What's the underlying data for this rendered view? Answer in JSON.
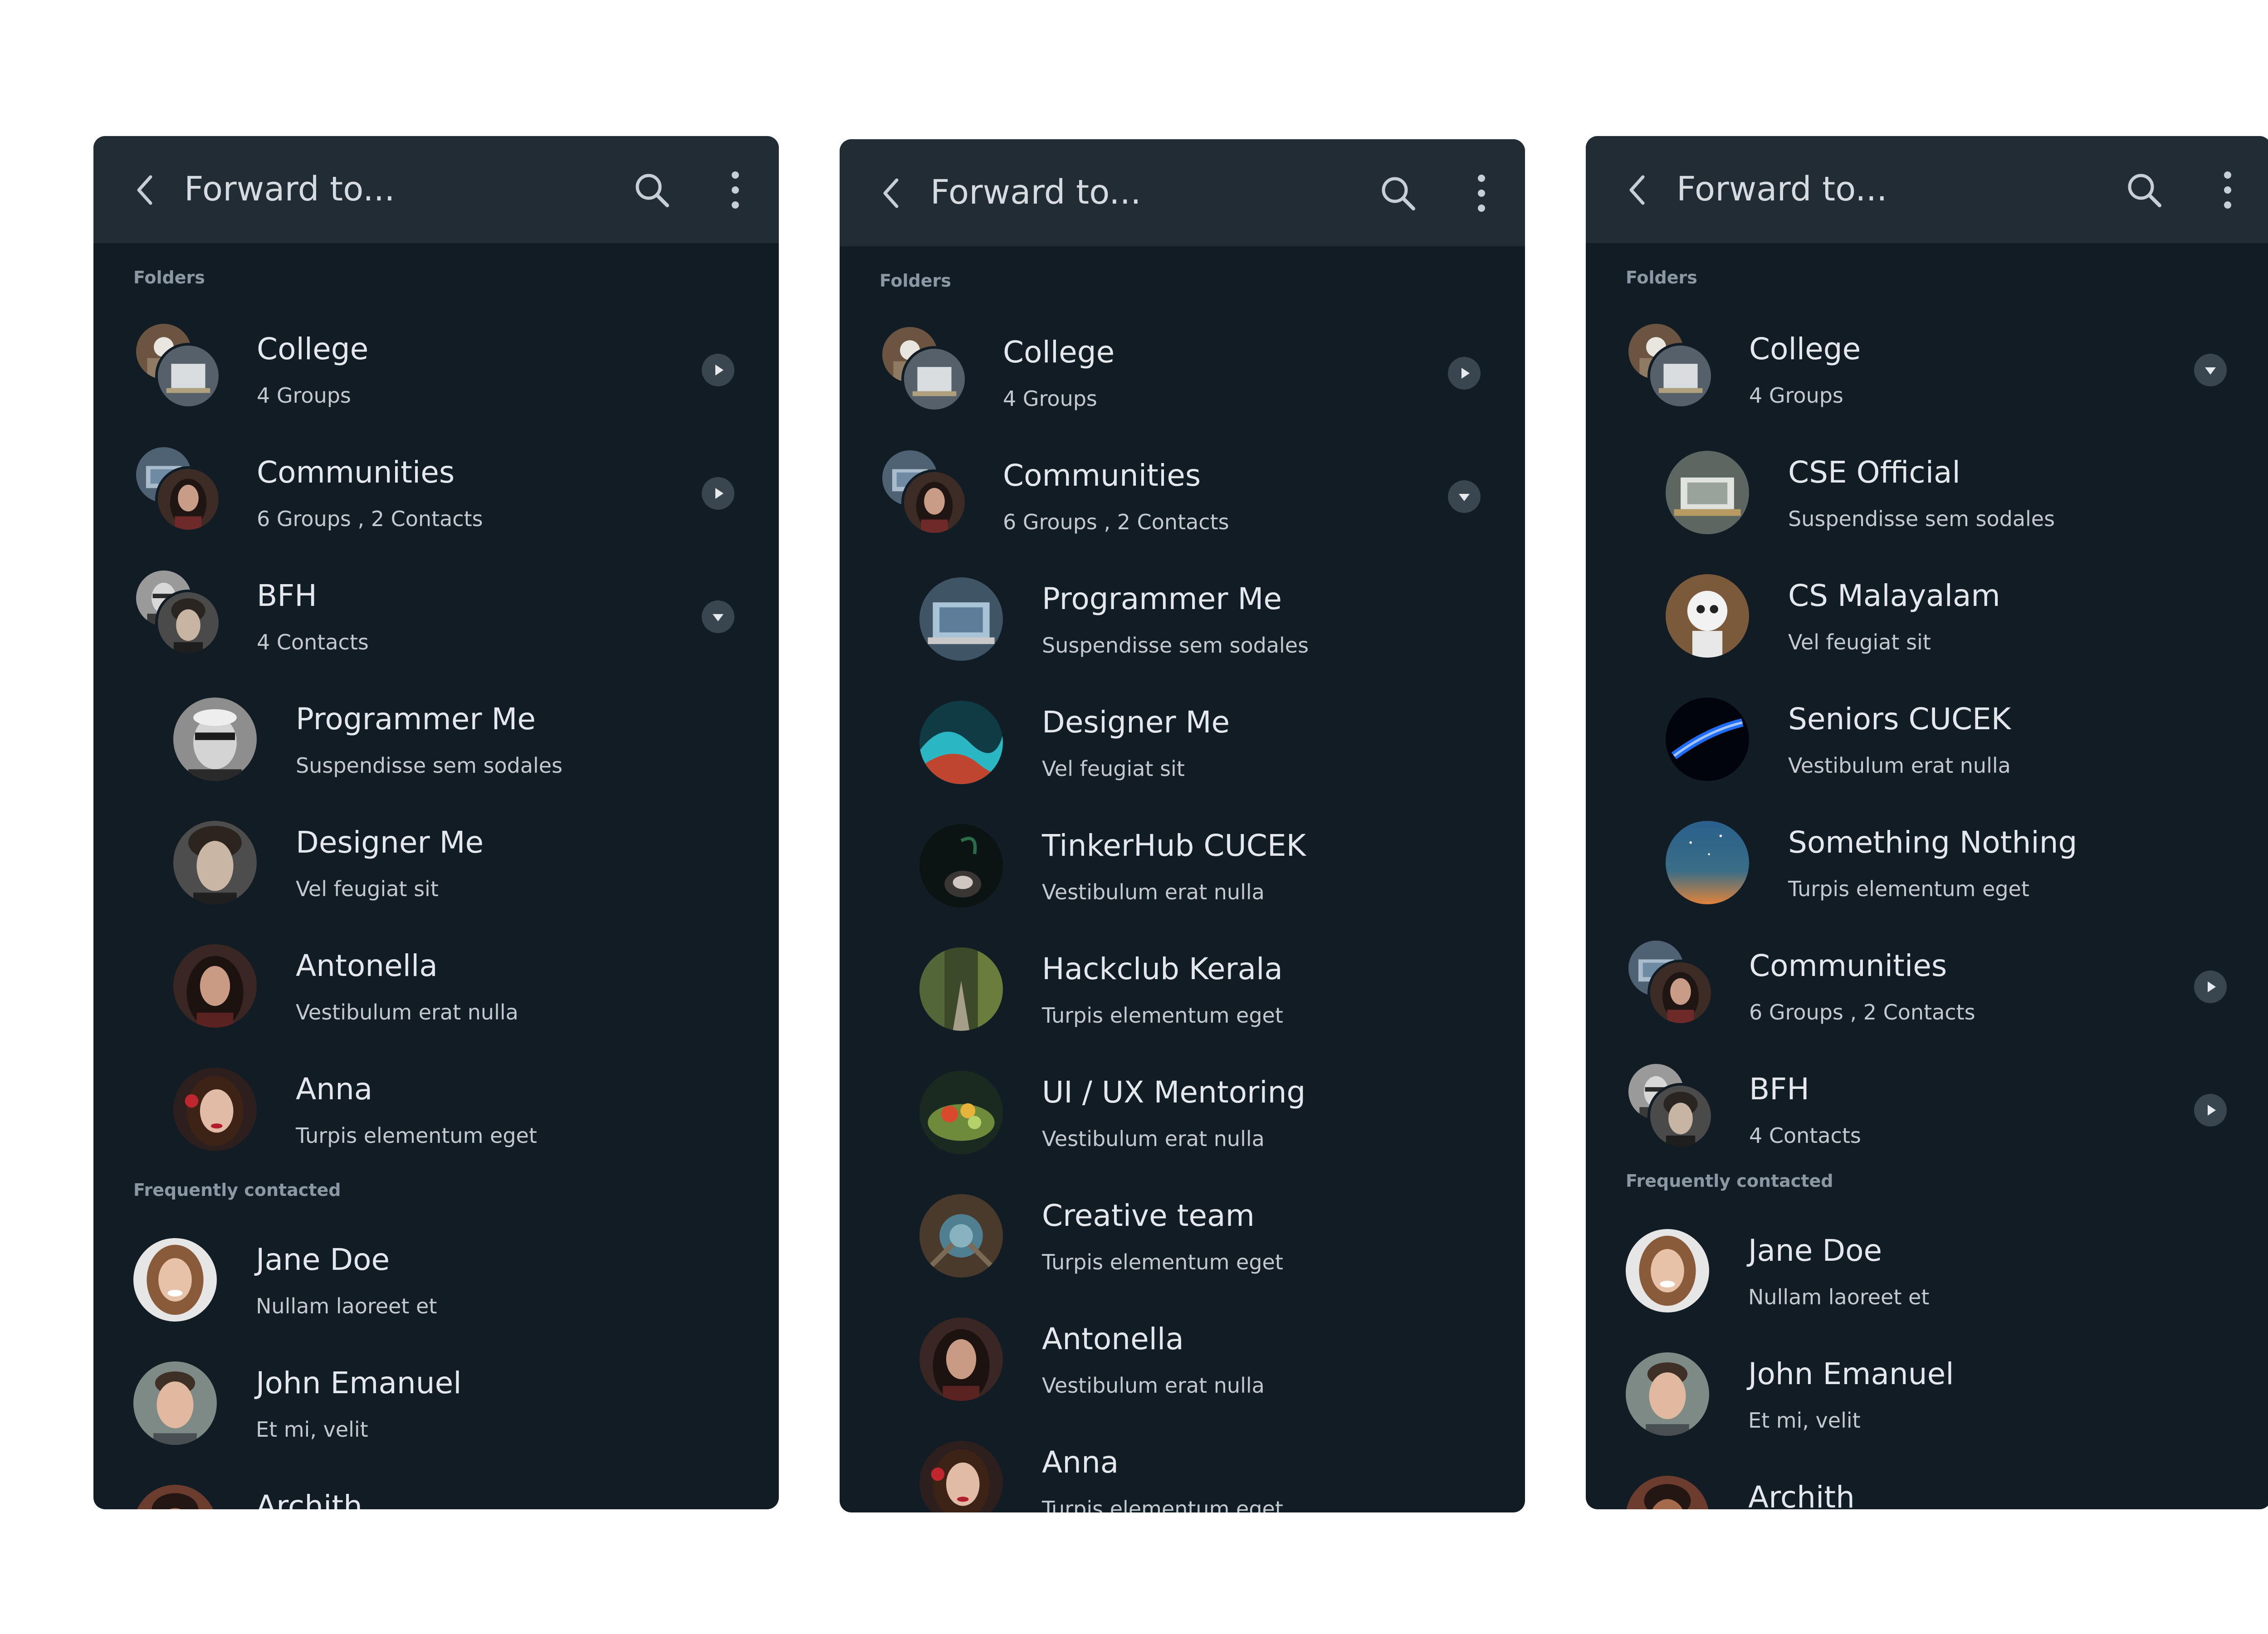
{
  "panels": [
    {
      "title": "Forward to...",
      "sections": {
        "folders": "Folders",
        "frequent": "Frequently contacted"
      },
      "folders": [
        {
          "name": "College",
          "subtitle": "4 Groups",
          "state": "collapsed"
        },
        {
          "name": "Communities",
          "subtitle": "6 Groups , 2 Contacts",
          "state": "collapsed"
        },
        {
          "name": "BFH",
          "subtitle": "4 Contacts",
          "state": "expanded"
        }
      ],
      "children": [
        {
          "name": "Programmer Me",
          "subtitle": "Suspendisse sem sodales"
        },
        {
          "name": "Designer Me",
          "subtitle": "Vel feugiat sit"
        },
        {
          "name": "Antonella",
          "subtitle": "Vestibulum erat nulla"
        },
        {
          "name": "Anna",
          "subtitle": "Turpis elementum eget"
        }
      ],
      "frequent": [
        {
          "name": "Jane Doe",
          "subtitle": "Nullam laoreet et"
        },
        {
          "name": "John Emanuel",
          "subtitle": "Et mi, velit"
        },
        {
          "name": "Archith",
          "subtitle": ""
        }
      ]
    },
    {
      "title": "Forward to...",
      "sections": {
        "folders": "Folders"
      },
      "folders": [
        {
          "name": "College",
          "subtitle": "4 Groups",
          "state": "collapsed"
        },
        {
          "name": "Communities",
          "subtitle": "6 Groups , 2 Contacts",
          "state": "expanded"
        }
      ],
      "children": [
        {
          "name": "Programmer Me",
          "subtitle": "Suspendisse sem sodales"
        },
        {
          "name": "Designer Me",
          "subtitle": "Vel feugiat sit"
        },
        {
          "name": "TinkerHub CUCEK",
          "subtitle": "Vestibulum erat nulla"
        },
        {
          "name": "Hackclub Kerala",
          "subtitle": "Turpis elementum eget"
        },
        {
          "name": "UI / UX Mentoring",
          "subtitle": "Vestibulum erat nulla"
        },
        {
          "name": "Creative team",
          "subtitle": "Turpis elementum eget"
        },
        {
          "name": "Antonella",
          "subtitle": "Vestibulum erat nulla"
        },
        {
          "name": "Anna",
          "subtitle": "Turpis elementum eget"
        }
      ]
    },
    {
      "title": "Forward to...",
      "sections": {
        "folders": "Folders",
        "frequent": "Frequently contacted"
      },
      "folders": [
        {
          "name": "College",
          "subtitle": "4 Groups",
          "state": "expanded"
        },
        {
          "name": "Communities",
          "subtitle": "6 Groups , 2 Contacts",
          "state": "collapsed"
        },
        {
          "name": "BFH",
          "subtitle": "4 Contacts",
          "state": "collapsed"
        }
      ],
      "children": [
        {
          "name": "CSE Official",
          "subtitle": "Suspendisse sem sodales"
        },
        {
          "name": "CS Malayalam",
          "subtitle": "Vel feugiat sit"
        },
        {
          "name": "Seniors CUCEK",
          "subtitle": "Vestibulum erat nulla"
        },
        {
          "name": "Something Nothing",
          "subtitle": "Turpis elementum eget"
        }
      ],
      "frequent": [
        {
          "name": "Jane Doe",
          "subtitle": "Nullam laoreet et"
        },
        {
          "name": "John Emanuel",
          "subtitle": "Et mi, velit"
        },
        {
          "name": "Archith",
          "subtitle": ""
        }
      ]
    }
  ]
}
